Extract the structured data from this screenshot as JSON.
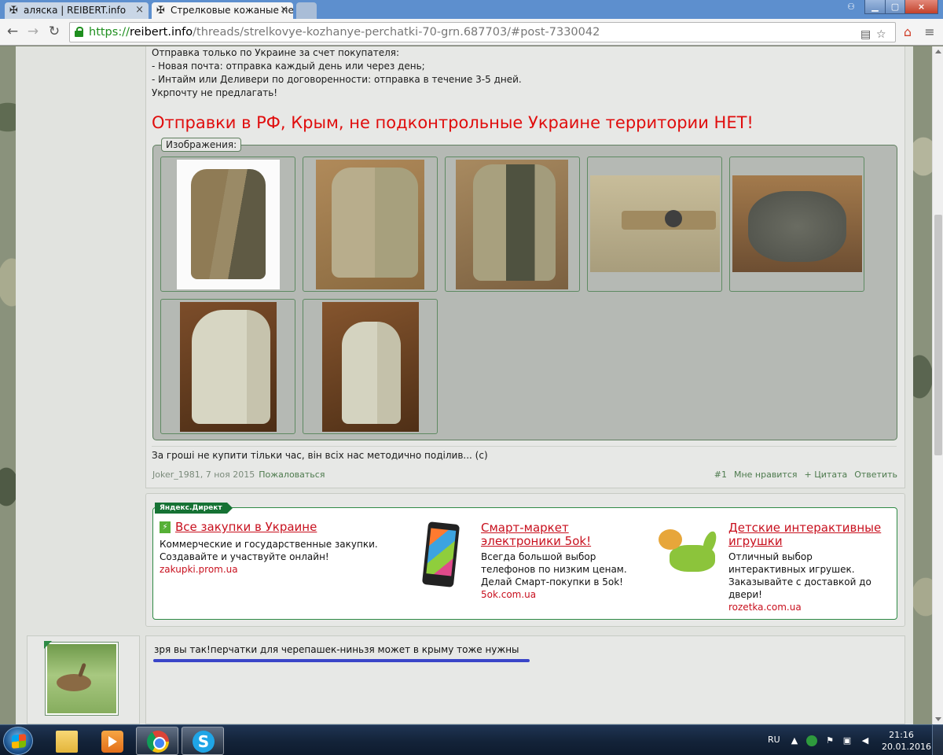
{
  "browser": {
    "tabs": [
      {
        "title": "аляска | REIBERT.info",
        "active": false
      },
      {
        "title": "Стрелковые кожаные пер",
        "active": true
      }
    ],
    "close_glyph": "×",
    "url": {
      "scheme": "https://",
      "host": "reibert.info",
      "path": "/threads/strelkovye-kozhanye-perchatki-70-grn.687703/#post-7330042"
    },
    "icons": [
      "back-icon",
      "forward-icon",
      "reload-icon",
      "lock-icon",
      "translate-icon",
      "star-icon",
      "extension-icon",
      "menu-icon"
    ]
  },
  "post": {
    "shipping_lines": [
      "Отправка только по Украине за счет покупателя:",
      "- Новая почта: отправка каждый день или через день;",
      "- Интайм или Деливери по договоренности: отправка в течение 3-5 дней.",
      "Укрпочту не предлагать!"
    ],
    "warning": "Отправки в РФ, Крым, не подконтрольные Украине территории НЕТ!",
    "images_label": "Изображения:",
    "signature": "За гроші не купити тільки час, він всіх нас методично поділив... (с)",
    "author_date": "Joker_1981, 7 ноя 2015",
    "report": "Пожаловаться",
    "post_number": "#1",
    "like": "Мне нравится",
    "quote": "+ Цитата",
    "reply": "Ответить"
  },
  "ads": {
    "label": "Яндекс.Директ",
    "items": [
      {
        "title": "Все закупки в Украине",
        "body": [
          "Коммерческие и государственные закупки.",
          "Создавайте и участвуйте онлайн!"
        ],
        "url": "zakupki.prom.ua"
      },
      {
        "title": [
          "Смарт-маркет",
          "электроники 5ok!"
        ],
        "body": [
          "Всегда большой выбор",
          "телефонов по низким ценам.",
          "Делай Смарт-покупки в 5ok!"
        ],
        "url": "5ok.com.ua"
      },
      {
        "title": [
          "Детские интерактивные",
          "игрушки"
        ],
        "body": [
          "Отличный выбор",
          "интерактивных игрушек.",
          "Заказывайте с доставкой до",
          "двери!"
        ],
        "url": "rozetka.com.ua"
      }
    ]
  },
  "reply_post": {
    "text": "зря вы так!перчатки для черепашек-ниньзя может в крыму тоже нужны"
  },
  "taskbar": {
    "lang": "RU",
    "time": "21:16",
    "date": "20.01.2016"
  }
}
